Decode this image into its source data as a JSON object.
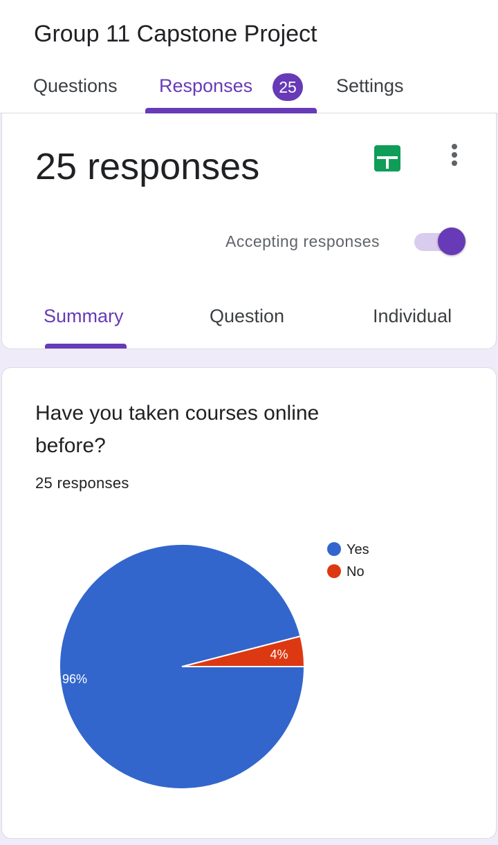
{
  "header": {
    "form_title": "Group 11 Capstone Project",
    "tabs": [
      {
        "label": "Questions",
        "active": false
      },
      {
        "label": "Responses",
        "active": true,
        "badge": "25"
      },
      {
        "label": "Settings",
        "active": false
      }
    ]
  },
  "summary_card": {
    "response_count_text": "25 responses",
    "sheets_icon": "google-sheets-icon",
    "more_icon": "more-vert-icon",
    "accepting_label": "Accepting responses",
    "accepting_on": true,
    "tabs": [
      {
        "label": "Summary",
        "active": true
      },
      {
        "label": "Question",
        "active": false
      },
      {
        "label": "Individual",
        "active": false
      }
    ]
  },
  "question_card": {
    "title": "Have you taken courses online before?",
    "responses_text": "25 responses"
  },
  "colors": {
    "accent": "#673ab7",
    "yes": "#3366cc",
    "no": "#dc3912",
    "sheets": "#0f9d58"
  },
  "chart_data": {
    "type": "pie",
    "categories": [
      "Yes",
      "No"
    ],
    "values": [
      96,
      4
    ],
    "labels": [
      "96%",
      "4%"
    ],
    "legend": "top-right"
  }
}
